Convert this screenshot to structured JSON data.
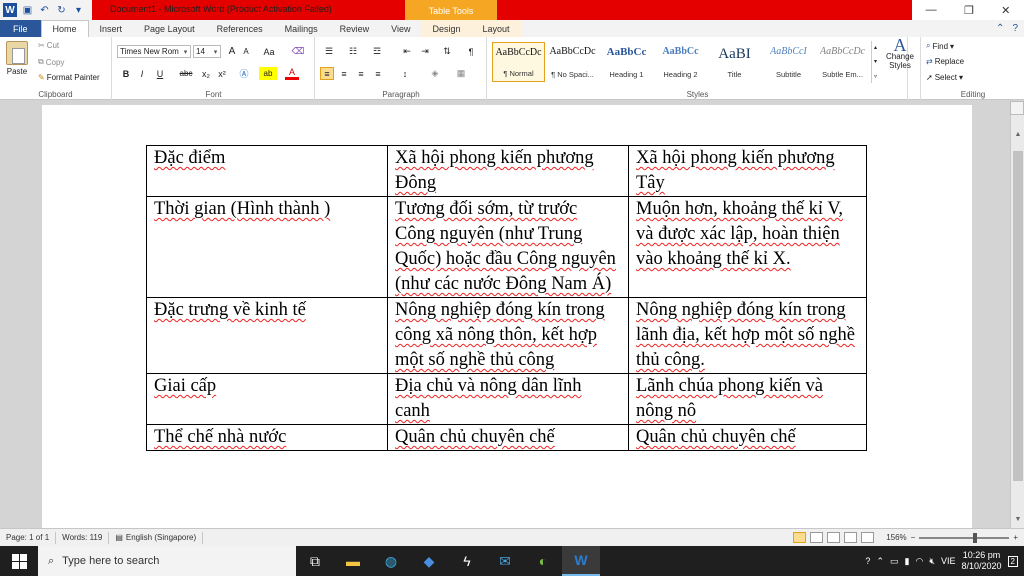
{
  "window": {
    "title": "Document1 - Microsoft Word (Product Activation Failed)",
    "contextual_tab_group": "Table Tools",
    "controls": {
      "minimize": "—",
      "maximize": "❐",
      "close": "✕"
    }
  },
  "tabs": [
    "File",
    "Home",
    "Insert",
    "Page Layout",
    "References",
    "Mailings",
    "Review",
    "View",
    "Design",
    "Layout"
  ],
  "ribbon": {
    "clipboard": {
      "paste": "Paste",
      "cut": "Cut",
      "copy": "Copy",
      "format_painter": "Format Painter",
      "label": "Clipboard"
    },
    "font": {
      "name": "Times New Rom",
      "size": "14",
      "label": "Font",
      "bold": "B",
      "italic": "I",
      "underline": "U",
      "strike": "abc",
      "sub": "x₂",
      "sup": "x²",
      "grow": "A",
      "shrink": "A",
      "case": "Aa",
      "highlight": "ab",
      "color": "A"
    },
    "paragraph": {
      "label": "Paragraph",
      "pilcrow": "¶"
    },
    "styles": {
      "label": "Styles",
      "items": [
        {
          "preview": "AaBbCcDc",
          "name": "¶ Normal"
        },
        {
          "preview": "AaBbCcDc",
          "name": "¶ No Spaci..."
        },
        {
          "preview": "AaBbCc",
          "name": "Heading 1"
        },
        {
          "preview": "AaBbCc",
          "name": "Heading 2"
        },
        {
          "preview": "AaBI",
          "name": "Title"
        },
        {
          "preview": "AaBbCcI",
          "name": "Subtitle"
        },
        {
          "preview": "AaBbCcDc",
          "name": "Subtle Em..."
        }
      ],
      "change_styles": "Change Styles"
    },
    "editing": {
      "label": "Editing",
      "find": "Find",
      "replace": "Replace",
      "select": "Select"
    }
  },
  "document": {
    "table": [
      [
        "Đặc điểm",
        "Xã hội phong kiến phương Đông",
        "Xã hội phong kiến phương Tây"
      ],
      [
        "Thời gian (Hình thành )",
        "Tương đối sớm, từ trước Công nguyên (như Trung Quốc) hoặc đầu Công nguyên (như các nước Đông Nam Á)",
        "Muộn hơn, khoảng thế kỉ V, và được xác lập, hoàn thiện vào khoảng thế kỉ X."
      ],
      [
        "Đặc trưng về kinh tế",
        "Nông nghiệp đóng kín trong công xã nông thôn, kết hợp một số nghề thủ công",
        "Nông nghiệp đóng kín trong lãnh địa, kết hợp một số nghề thủ công."
      ],
      [
        "Giai cấp",
        "Địa chủ và nông dân lĩnh canh",
        "Lãnh chúa phong kiến và nông nô"
      ],
      [
        "Thể chế nhà nước",
        "Quân chủ chuyên chế",
        "Quân chủ chuyên chế"
      ]
    ]
  },
  "status": {
    "page": "Page: 1 of 1",
    "words": "Words: 119",
    "language": "English (Singapore)",
    "zoom": "156%",
    "zoom_minus": "−",
    "zoom_plus": "+"
  },
  "taskbar": {
    "search_placeholder": "Type here to search",
    "lang": "VIE",
    "time": "10:26 pm",
    "date": "8/10/2020",
    "notifications": "2"
  }
}
